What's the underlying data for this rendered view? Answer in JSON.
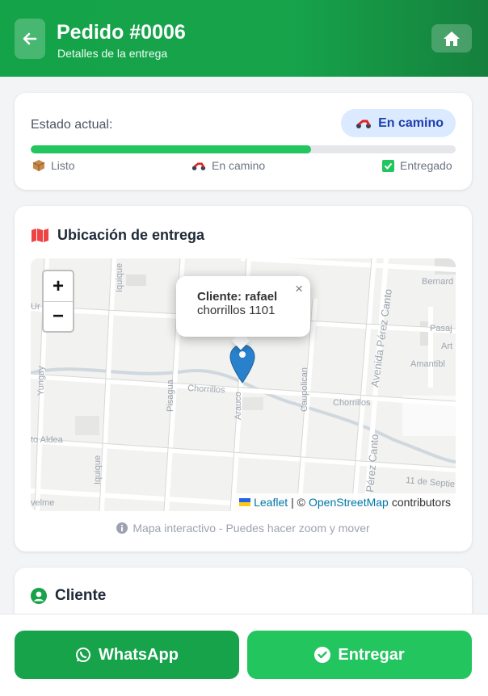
{
  "header": {
    "title": "Pedido #0006",
    "subtitle": "Detalles de la entrega"
  },
  "status": {
    "label": "Estado actual:",
    "badge": "En camino",
    "progress_percent": 66,
    "steps": [
      {
        "label": "Listo",
        "icon": "box-icon"
      },
      {
        "label": "En camino",
        "icon": "motorcycle-icon"
      },
      {
        "label": "Entregado",
        "icon": "checkbox-icon"
      }
    ]
  },
  "map_section": {
    "title": "Ubicación de entrega",
    "zoom_in": "+",
    "zoom_out": "−",
    "popup": {
      "name": "Cliente: rafael",
      "address": "chorrillos 1101",
      "close": "×"
    },
    "attribution": {
      "leaflet": "Leaflet",
      "separator": "| ©",
      "osm": "OpenStreetMap",
      "suffix": "contributors"
    },
    "street_labels": [
      "Iquique",
      "Yungay",
      "Pisagua",
      "Chorrillos",
      "Arauco",
      "Caupolican",
      "Avenida Pérez Canto",
      "Pérez Canto",
      "Amantibl",
      "Pasaj",
      "Art",
      "Bernard",
      "Chorrillos",
      "Iquique",
      "to Aldea",
      "velme",
      "11 de Septie"
    ],
    "hint": "Mapa interactivo - Puedes hacer zoom y mover"
  },
  "client": {
    "title": "Cliente"
  },
  "footer": {
    "whatsapp_label": "WhatsApp",
    "deliver_label": "Entregar"
  },
  "colors": {
    "primary_green": "#16a34a",
    "accent_green": "#22c55e",
    "badge_blue_bg": "#dbeafe",
    "badge_blue_text": "#1e40af"
  }
}
